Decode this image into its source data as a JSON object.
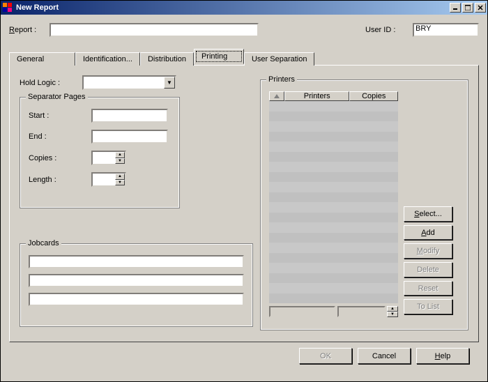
{
  "window": {
    "title": "New Report"
  },
  "top": {
    "report_label": "Report :",
    "report_value": "",
    "userid_label": "User ID :",
    "userid_value": "BRY"
  },
  "tabs": {
    "general": "General",
    "identification": "Identification...",
    "distribution": "Distribution",
    "printing": "Printing",
    "user_separation": "User Separation"
  },
  "printing": {
    "hold_logic_label": "Hold Logic :",
    "hold_logic_value": "",
    "separator_legend": "Separator Pages",
    "start_label": "Start :",
    "start_value": "",
    "end_label": "End :",
    "end_value": "",
    "copies_label": "Copies :",
    "copies_value": "",
    "length_label": "Length :",
    "length_value": "",
    "jobcards_legend": "Jobcards",
    "jobcard1": "",
    "jobcard2": "",
    "jobcard3": ""
  },
  "printers": {
    "legend": "Printers",
    "col_printers": "Printers",
    "col_copies": "Copies",
    "footer_printer": "",
    "footer_copies": ""
  },
  "side_btns": {
    "select": "Select...",
    "add": "Add",
    "modify": "Modify",
    "delete": "Delete",
    "reset": "Reset",
    "tolist": "To List"
  },
  "bottom_btns": {
    "ok": "OK",
    "cancel": "Cancel",
    "help": "Help"
  },
  "colors": {
    "titlebar_start": "#0a246a",
    "titlebar_end": "#a6caf0",
    "face": "#d4d0c8"
  }
}
